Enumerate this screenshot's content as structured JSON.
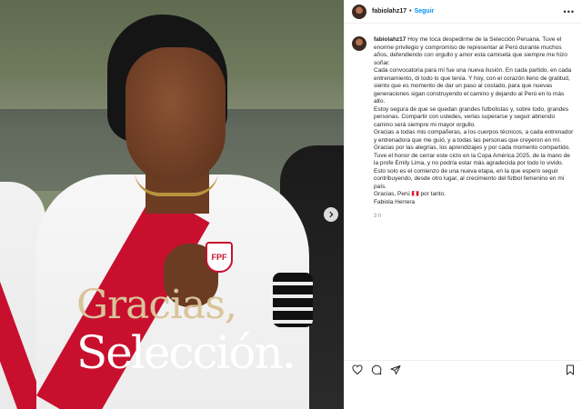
{
  "post": {
    "username": "fabiolahz17",
    "separator": "•",
    "follow_label": "Seguir",
    "more_label": "•••",
    "overlay": {
      "line1": "Gracias,",
      "line2": "Selección."
    },
    "jersey_crest": "FPF",
    "caption": {
      "username": "fabiolahz17",
      "paragraphs": [
        "Hoy me toca despedirme de la Selección Peruana. Tuve el enorme privilegio y compromiso de representar al Perú durante muchos años, defendiendo con orgullo y amor esta camiseta que siempre me hizo soñar.",
        "Cada convocatoria para mí fue una nueva ilusión. En cada partido, en cada entrenamiento, di todo lo que tenía. Y hoy, con el corazón lleno de gratitud, siento que es momento de dar un paso al costado, para que nuevas generaciones sigan construyendo el camino y dejando al Perú en lo más alto.",
        "Estoy segura de que se quedan grandes futbolistas y, sobre todo, grandes personas. Compartir con ustedes, verlas superarse y seguir abriendo camino será siempre mi mayor orgullo.",
        "Gracias a todas mis compañeras, a los cuerpos técnicos, a cada entrenador y entrenadora que me guió, y a todas las personas que creyeron en mí. Gracias por las alegrías, los aprendizajes y por cada momento compartido.",
        "Tuve el honor de cerrar este ciclo en la Copa América 2025, de la mano de la profe Emily Lima, y no podría estar más agradecida por todo lo vivido.",
        "Esto solo es el comienzo de una nueva etapa, en la que espero seguir contribuyendo, desde otro lugar, al crecimiento del fútbol femenino en mi país.",
        "Gracias, Perú 🇵🇪 por tanto.",
        "Fabiola Herrera"
      ],
      "timestamp": "3 h"
    },
    "icons": {
      "like": "heart-icon",
      "comment": "comment-icon",
      "share": "share-icon",
      "save": "bookmark-icon",
      "next": "chevron-right-icon"
    },
    "colors": {
      "follow": "#0095f6",
      "peru_red": "#c8102e",
      "overlay_gold": "#d9c49a"
    }
  }
}
